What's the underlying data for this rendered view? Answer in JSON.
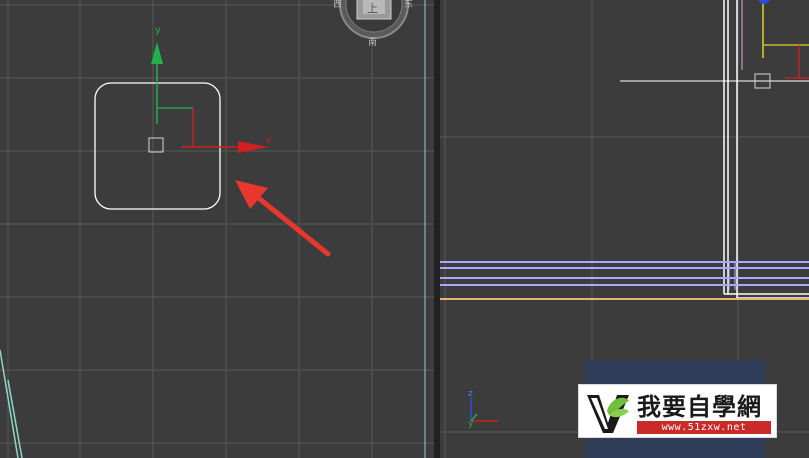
{
  "viewports": {
    "left": {
      "gizmo": {
        "y_label": "y",
        "x_label": "x"
      },
      "viewcube": {
        "face_label": "上",
        "south_label": "南",
        "west_label": "西",
        "east_label": "东"
      }
    },
    "right": {
      "axis_tripod": {
        "z_label": "z",
        "y_label": "y"
      }
    }
  },
  "watermark": {
    "brand": "我要自學網",
    "url": "www.51zxw.net"
  },
  "colors": {
    "viewport_bg": "#3c3c3c",
    "grid": "#5a5a5a",
    "shape_outline": "#ffffff",
    "axis_x": "#d21f1f",
    "axis_y": "#22b04a",
    "axis_z": "#2a4fd6",
    "annotation_arrow": "#e8382d",
    "highlight_lines": "#a8a8ff",
    "ground_line": "#e8b86a"
  }
}
